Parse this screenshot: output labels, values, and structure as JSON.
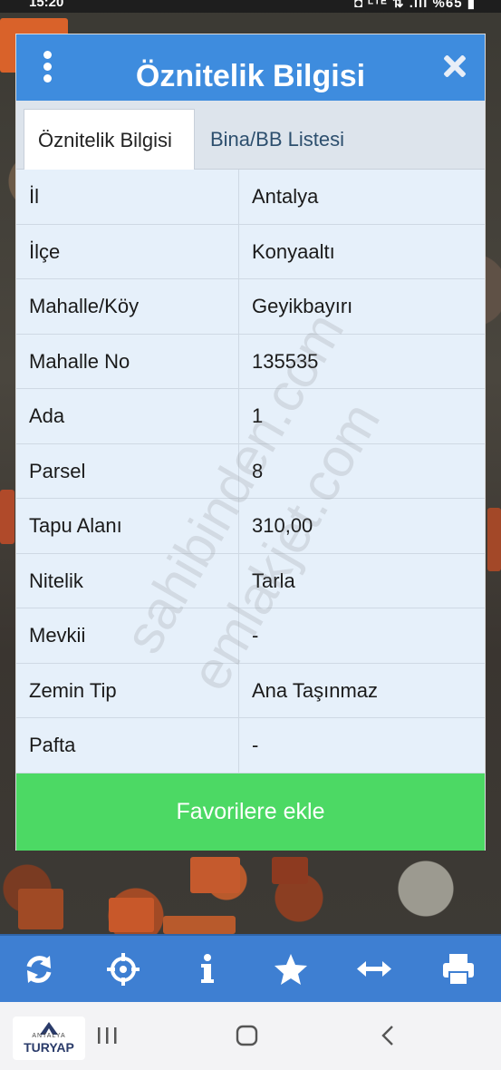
{
  "status_bar": {
    "time": "15:20",
    "indicators": "◘ ᴸᵀᴱ ⇅ .ıll %65 ▮"
  },
  "dialog": {
    "title": "Öznitelik Bilgisi",
    "tabs": [
      {
        "label": "Öznitelik Bilgisi",
        "active": true
      },
      {
        "label": "Bina/BB Listesi",
        "active": false
      }
    ],
    "rows": [
      {
        "key": "İl",
        "value": "Antalya"
      },
      {
        "key": "İlçe",
        "value": "Konyaaltı"
      },
      {
        "key": "Mahalle/Köy",
        "value": "Geyikbayırı"
      },
      {
        "key": "Mahalle No",
        "value": "135535"
      },
      {
        "key": "Ada",
        "value": "1"
      },
      {
        "key": "Parsel",
        "value": "8"
      },
      {
        "key": "Tapu Alanı",
        "value": "310,00"
      },
      {
        "key": "Nitelik",
        "value": "Tarla"
      },
      {
        "key": "Mevkii",
        "value": "-"
      },
      {
        "key": "Zemin Tip",
        "value": "Ana Taşınmaz"
      },
      {
        "key": "Pafta",
        "value": "-"
      }
    ],
    "favorite_button": "Favorilere ekle"
  },
  "watermarks": [
    "sahibinden.com",
    "emlakjet.com"
  ],
  "toolbar": {
    "icons": [
      "refresh-icon",
      "locate-icon",
      "info-icon",
      "star-icon",
      "measure-icon",
      "print-icon"
    ]
  },
  "logo": {
    "small_text": "ANTALYA",
    "text": "TURYAP"
  },
  "colors": {
    "header": "#3e8cde",
    "button": "#4cd964",
    "toolbar": "#3e7fd2",
    "row": "#e6f0fa"
  }
}
